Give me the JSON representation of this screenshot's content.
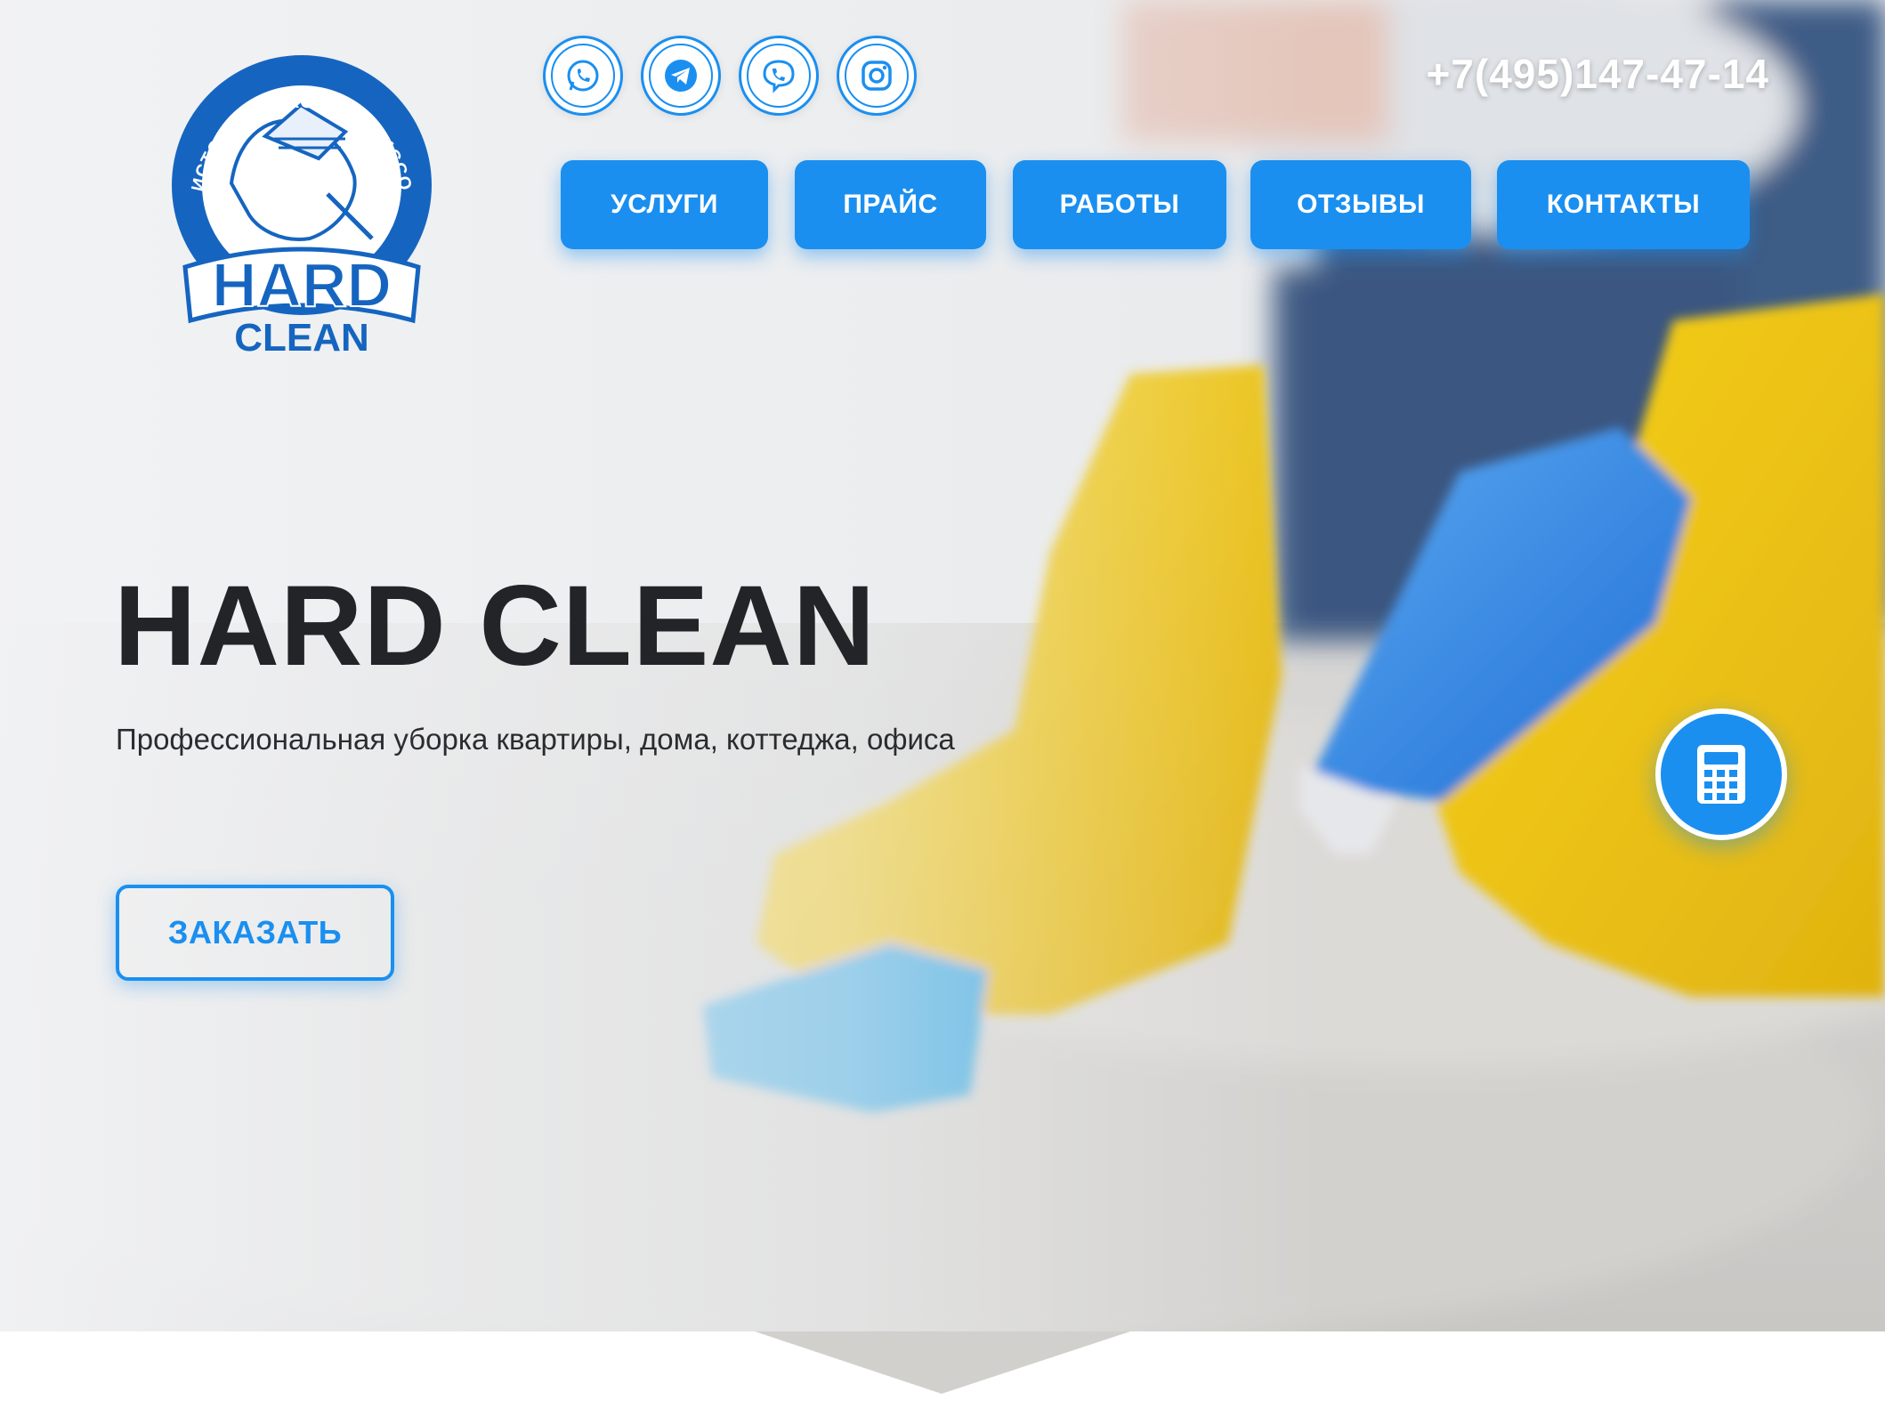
{
  "header": {
    "logo": {
      "arc_text": "ЧИСТОТА БЕЗ КОМПРОМИССОВ",
      "brand_line1": "HARD",
      "brand_line2": "CLEAN"
    },
    "social": [
      {
        "icon": "whatsapp-icon"
      },
      {
        "icon": "telegram-icon"
      },
      {
        "icon": "viber-icon"
      },
      {
        "icon": "instagram-icon"
      }
    ],
    "phone": "+7(495)147-47-14"
  },
  "nav": {
    "items": [
      {
        "label": "УСЛУГИ"
      },
      {
        "label": "ПРАЙС"
      },
      {
        "label": "РАБОТЫ"
      },
      {
        "label": "ОТЗЫВЫ"
      },
      {
        "label": "КОНТАКТЫ"
      }
    ]
  },
  "hero": {
    "title": "HARD CLEAN",
    "subtitle": "Профессиональная уборка квартиры, дома, коттеджа, офиса",
    "order_label": "ЗАКАЗАТЬ"
  },
  "widgets": {
    "calculator_icon": "calculator-icon"
  },
  "colors": {
    "accent": "#1a8ff0",
    "title_text": "#222427",
    "logo_blue": "#1565c0"
  }
}
